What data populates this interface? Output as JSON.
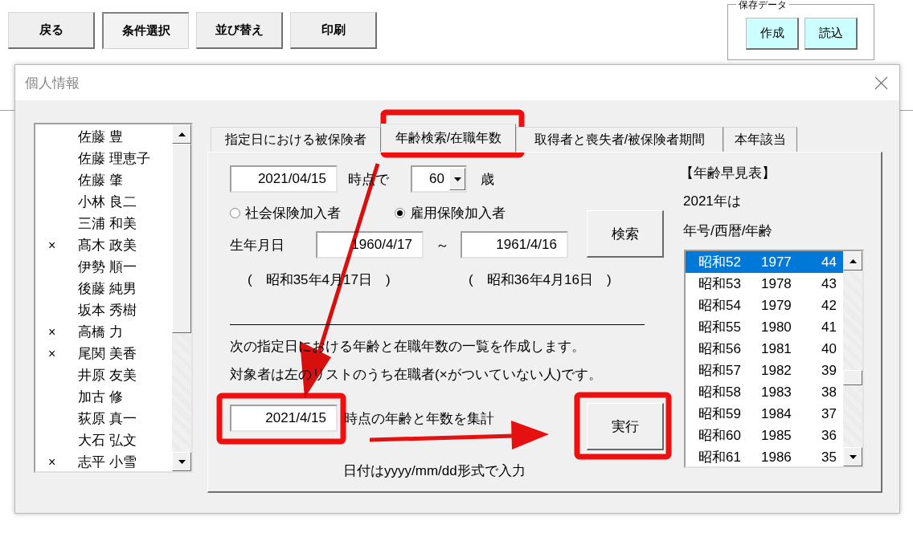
{
  "toolbar": {
    "buttons": [
      {
        "label": "戻る",
        "selected": false
      },
      {
        "label": "条件選択",
        "selected": true
      },
      {
        "label": "並び替え",
        "selected": false
      },
      {
        "label": "印刷",
        "selected": false
      }
    ]
  },
  "saved_data": {
    "title": "保存データ",
    "buttons": [
      "作成",
      "読込"
    ]
  },
  "dialog": {
    "title": "個人情報",
    "people": [
      {
        "name": "佐藤 豊"
      },
      {
        "name": "佐藤 理恵子"
      },
      {
        "name": "佐藤 肇"
      },
      {
        "name": "小林 良二"
      },
      {
        "name": "三浦 和美"
      },
      {
        "mark": "×",
        "name": "髙木 政美"
      },
      {
        "name": "伊勢 順一"
      },
      {
        "name": "後藤 純男"
      },
      {
        "name": "坂本 秀樹"
      },
      {
        "mark": "×",
        "name": "高橋 力"
      },
      {
        "mark": "×",
        "name": "尾関 美香"
      },
      {
        "name": "井原 友美"
      },
      {
        "name": "加古 修"
      },
      {
        "name": "荻原 真一"
      },
      {
        "name": "大石 弘文"
      },
      {
        "mark": "×",
        "name": "志平 小雪"
      }
    ],
    "tabs": [
      {
        "label": "指定日における被保険者",
        "selected": false
      },
      {
        "label": "年齢検索/在職年数",
        "selected": true
      },
      {
        "label": "取得者と喪失者/被保険者期間",
        "selected": false
      },
      {
        "label": "本年該当",
        "selected": false
      }
    ],
    "search": {
      "date": "2021/04/15",
      "date_suffix": "時点で",
      "age": "60",
      "age_unit": "歳",
      "options": [
        {
          "label": "社会保険加入者",
          "selected": false
        },
        {
          "label": "雇用保険加入者",
          "selected": true
        }
      ],
      "search_button": "検索",
      "birth_label": "生年月日",
      "birth_from": "1960/4/17",
      "range_sign": "～",
      "birth_to": "1961/4/16",
      "era_from": "(　昭和35年4月17日　)",
      "era_to": "(　昭和36年4月16日　)"
    },
    "tally": {
      "lines": [
        "次の指定日における年齢と在職年数の一覧を作成します。",
        "対象者は左のリストのうち在職者(×がついていない人)です。"
      ],
      "date": "2021/4/15",
      "date_suffix": "時点の年齢と年数を集計",
      "run_button": "実行",
      "hint": "日付はyyyy/mm/dd形式で入力"
    },
    "age_table": {
      "title": "【年齢早見表】",
      "year_note": "2021年は",
      "columns_note": "年号/西暦/年齢",
      "rows": [
        {
          "era": "昭和52",
          "year": "1977",
          "age": "44",
          "selected": true
        },
        {
          "era": "昭和53",
          "year": "1978",
          "age": "43",
          "selected": false
        },
        {
          "era": "昭和54",
          "year": "1979",
          "age": "42",
          "selected": false
        },
        {
          "era": "昭和55",
          "year": "1980",
          "age": "41",
          "selected": false
        },
        {
          "era": "昭和56",
          "year": "1981",
          "age": "40",
          "selected": false
        },
        {
          "era": "昭和57",
          "year": "1982",
          "age": "39",
          "selected": false
        },
        {
          "era": "昭和58",
          "year": "1983",
          "age": "38",
          "selected": false
        },
        {
          "era": "昭和59",
          "year": "1984",
          "age": "37",
          "selected": false
        },
        {
          "era": "昭和60",
          "year": "1985",
          "age": "36",
          "selected": false
        },
        {
          "era": "昭和61",
          "year": "1986",
          "age": "35",
          "selected": false
        }
      ]
    }
  }
}
